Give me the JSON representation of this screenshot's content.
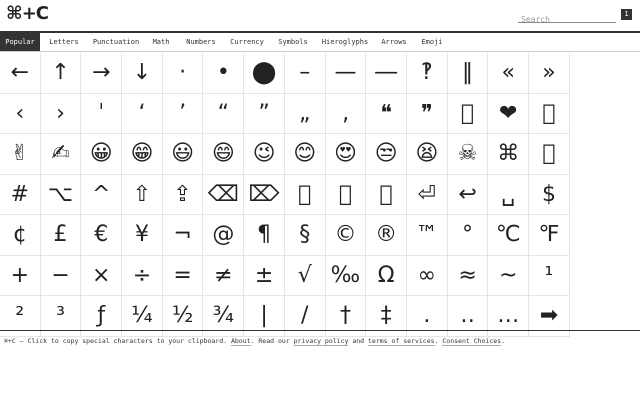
{
  "header": {
    "logo": "⌘+C",
    "search_placeholder": "Search",
    "search_button": "1"
  },
  "nav": {
    "tabs": [
      "Popular",
      "Letters",
      "Punctuation",
      "Math",
      "Numbers",
      "Currency",
      "Symbols",
      "Hieroglyphs",
      "Arrows",
      "Emoji"
    ],
    "active": "Popular"
  },
  "characters": [
    "←",
    "↑",
    "→",
    "↓",
    "·",
    "•",
    "⬤",
    "–",
    "—",
    "―",
    "‽",
    "‖",
    "«",
    "»",
    "‹",
    "›",
    "ˈ",
    "‘",
    "’",
    "“",
    "”",
    "„",
    "‚",
    "❝",
    "❞",
    "\u0000",
    "❤",
    "\u0000",
    "✌",
    "✍",
    "😀",
    "😁",
    "😃",
    "😄",
    "😉",
    "😊",
    "😍",
    "😒",
    "😫",
    "☠",
    "⌘",
    "\u0000",
    "#",
    "⌥",
    "^",
    "⇧",
    "⇪",
    "⌫",
    "⌦",
    "\u0000",
    "\u0000",
    "\u0000",
    "⏎",
    "↩",
    "␣",
    "$",
    "¢",
    "£",
    "€",
    "¥",
    "¬",
    "@",
    "¶",
    "§",
    "©",
    "®",
    "™",
    "°",
    "℃",
    "℉",
    "+",
    "−",
    "×",
    "÷",
    "=",
    "≠",
    "±",
    "√",
    "‰",
    "Ω",
    "∞",
    "≈",
    "~",
    "¹",
    "²",
    "³",
    "ƒ",
    "¼",
    "½",
    "¾",
    "|",
    "/",
    "†",
    "‡",
    ".",
    "‥",
    "…",
    "➡"
  ],
  "footer": {
    "intro": "⌘+C – Click to copy special characters to your clipboard.",
    "about": "About",
    "read_our": ". Read our",
    "privacy": "privacy policy",
    "and": "and",
    "terms": "terms of services",
    "period": ".",
    "consent": "Consent Choices",
    "end": "."
  }
}
